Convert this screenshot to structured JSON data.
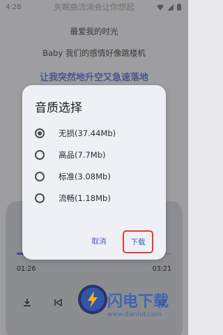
{
  "status_bar": {
    "time": "4:28"
  },
  "lyrics": [
    {
      "text": "失眠曲流淌会让你想起",
      "style": "faded"
    },
    {
      "text": "最爱我的时光",
      "style": "normal"
    },
    {
      "text": "Baby 我们的感情好像跳楼机",
      "style": "normal"
    },
    {
      "text": "让我突然地升空又急速落地",
      "style": "active"
    }
  ],
  "player": {
    "current_time": "01:26",
    "total_time": "03:21",
    "progress_fraction": 0.43
  },
  "dialog": {
    "title": "音质选择",
    "options": [
      {
        "label": "无损(37.44Mb)",
        "checked": true
      },
      {
        "label": "高品(7.7Mb)",
        "checked": false
      },
      {
        "label": "标准(3.08Mb)",
        "checked": false
      },
      {
        "label": "流畅(1.18Mb)",
        "checked": false
      }
    ],
    "cancel_label": "取消",
    "download_label": "下载"
  },
  "watermark": {
    "text": "闪电下载",
    "url": "www.dianlut.com"
  },
  "colors": {
    "accent": "#4a5bb5",
    "highlight_border": "#e33b2e",
    "active_lyric": "#6b7fd0"
  }
}
